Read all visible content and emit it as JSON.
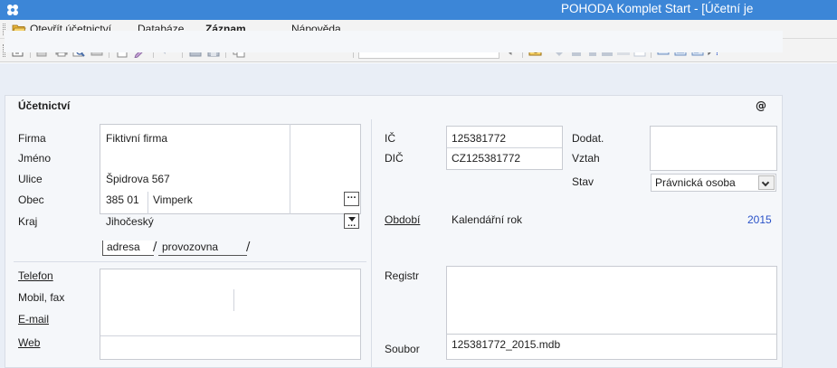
{
  "window": {
    "title": "POHODA Komplet Start - [Účetní je"
  },
  "menu": {
    "items": [
      "Otevřít účetnictví",
      "Databáze",
      "Záznam",
      "Nápověda"
    ]
  },
  "section": {
    "title": "Účetnictví",
    "email_symbol": "@"
  },
  "address": {
    "labels": {
      "firma": "Firma",
      "jmeno": "Jméno",
      "ulice": "Ulice",
      "obec": "Obec",
      "kraj": "Kraj"
    },
    "values": {
      "firma": "Fiktivní firma",
      "jmeno": "",
      "ulice": "Špidrova 567",
      "psc": "385 01",
      "obec": "Vimperk",
      "kraj": "Jihočeský"
    },
    "tabs": [
      "adresa",
      "provozovna"
    ],
    "active_tab": "adresa"
  },
  "contact": {
    "labels": {
      "telefon": "Telefon",
      "mobil_fax": "Mobil, fax",
      "email": "E-mail",
      "web": "Web"
    }
  },
  "ids": {
    "labels": {
      "ic": "IČ",
      "dic": "DIČ",
      "dodat": "Dodat.",
      "vztah": "Vztah",
      "stav": "Stav"
    },
    "values": {
      "ic": "125381772",
      "dic": "CZ125381772",
      "stav": "Právnická osoba"
    }
  },
  "period": {
    "label": "Období",
    "value": "Kalendářní rok",
    "year": "2015"
  },
  "registry": {
    "registr_label": "Registr",
    "soubor_label": "Soubor",
    "soubor_value": "125381772_2015.mdb"
  },
  "colors": {
    "titlebar": "#3c86d7",
    "year_link": "#2a52c8",
    "main_bg": "#e9eef6"
  }
}
